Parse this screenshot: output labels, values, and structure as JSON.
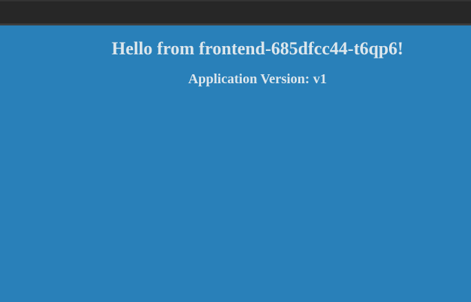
{
  "page": {
    "heading": "Hello from frontend-685dfcc44-t6qp6!",
    "version_text": "Application Version: v1"
  },
  "colors": {
    "background": "#2980b9",
    "topbar": "#272727",
    "text": "#dce6ec"
  }
}
